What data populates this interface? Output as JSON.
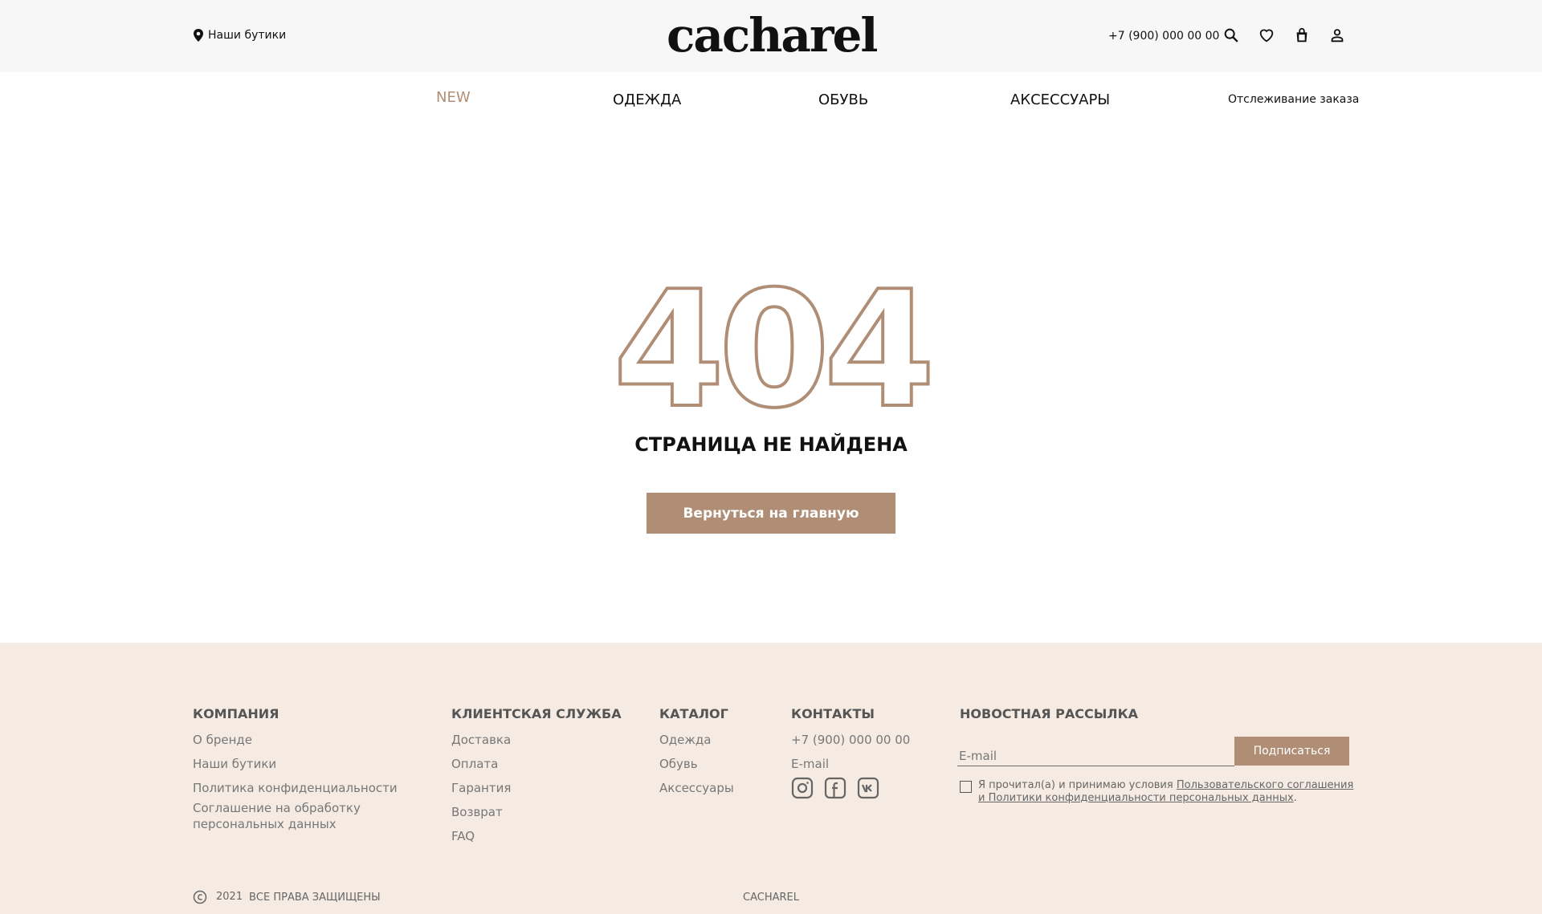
{
  "header": {
    "boutiques": "Наши бутики",
    "logo": "cacharel",
    "phone": "+7 (900) 000 00 00"
  },
  "nav": {
    "new": "NEW",
    "clothes": "ОДЕЖДА",
    "shoes": "ОБУВЬ",
    "accessories": "АКСЕССУАРЫ",
    "tracking": "Отслеживание заказа"
  },
  "main": {
    "code": "404",
    "title": "СТРАНИЦА НЕ НАЙДЕНА",
    "button": "Вернуться на главную"
  },
  "footer": {
    "company": {
      "heading": "КОМПАНИЯ",
      "links": [
        "О бренде",
        "Наши бутики",
        "Политика конфиденциальности",
        "Соглашение на обработку персональных данных"
      ]
    },
    "service": {
      "heading": "КЛИЕНТСКАЯ СЛУЖБА",
      "links": [
        "Доставка",
        "Оплата",
        "Гарантия",
        "Возврат",
        "FAQ"
      ]
    },
    "catalog": {
      "heading": "КАТАЛОГ",
      "links": [
        "Одежда",
        "Обувь",
        "Аксессуары"
      ]
    },
    "contacts": {
      "heading": "КОНТАКТЫ",
      "phone": "+7 (900) 000 00 00",
      "email": "E-mail"
    },
    "newsletter": {
      "heading": "НОВОСТНАЯ РАССЫЛКА",
      "placeholder": "E-mail",
      "button": "Подписаться",
      "consent_prefix": "Я прочитал(а) и принимаю условия ",
      "consent_link": "Пользовательского соглашения и Политики конфиденциальности персональных данных",
      "consent_suffix": "."
    },
    "year": "2021",
    "rights": "ВСЕ ПРАВА ЗАЩИЩЕНЫ",
    "brand": "CACHAREL"
  },
  "colors": {
    "accent": "#b08e76",
    "footer_bg": "#f5ebe3",
    "header_bg": "#f7f7f7"
  }
}
